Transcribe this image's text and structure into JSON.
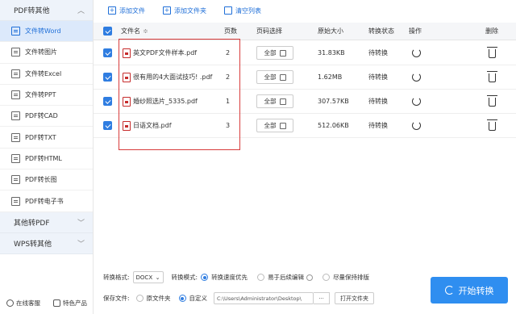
{
  "sidebar": {
    "section_main": "PDF转其他",
    "items": [
      {
        "label": "文件转Word",
        "icon": "word-file-icon",
        "active": true
      },
      {
        "label": "文件转图片",
        "icon": "image-file-icon"
      },
      {
        "label": "文件转Excel",
        "icon": "excel-file-icon"
      },
      {
        "label": "文件转PPT",
        "icon": "ppt-file-icon"
      },
      {
        "label": "PDF转CAD",
        "icon": "cad-file-icon"
      },
      {
        "label": "PDF转TXT",
        "icon": "txt-file-icon"
      },
      {
        "label": "PDF转HTML",
        "icon": "html-file-icon"
      },
      {
        "label": "PDF转长图",
        "icon": "long-image-icon"
      },
      {
        "label": "PDF转电子书",
        "icon": "ebook-icon"
      }
    ],
    "section_other": "其他转PDF",
    "section_wps": "WPS转其他",
    "footer": {
      "service": "在线客服",
      "products": "特色产品"
    }
  },
  "toolbar": {
    "add_file": "添加文件",
    "add_folder": "添加文件夹",
    "clear_list": "清空列表"
  },
  "table": {
    "headers": {
      "name": "文件名",
      "sort": "≑",
      "pages": "页数",
      "page_select": "页码选择",
      "size": "原始大小",
      "status": "转换状态",
      "action": "操作",
      "delete": "删除"
    },
    "page_btn_label": "全部",
    "rows": [
      {
        "name": "英文PDF文件样本.pdf",
        "pages": "2",
        "size": "31.83KB",
        "status": "待转换"
      },
      {
        "name": "很有用的4大面试技巧! .pdf",
        "pages": "2",
        "size": "1.62MB",
        "status": "待转换"
      },
      {
        "name": "婚纱照选片_5335.pdf",
        "pages": "1",
        "size": "307.57KB",
        "status": "待转换"
      },
      {
        "name": "日语文档.pdf",
        "pages": "3",
        "size": "512.06KB",
        "status": "待转换"
      }
    ]
  },
  "bottom": {
    "format_label": "转换格式:",
    "format_value": "DOCX",
    "mode_label": "转换模式:",
    "mode_fast": "转换速度优先",
    "mode_edit": "易于后续编辑",
    "mode_layout": "尽量保持排版",
    "save_label": "保存文件:",
    "save_original": "原文件夹",
    "save_custom": "自定义",
    "save_path": "C:\\Users\\Administrator\\Desktop\\",
    "dots": "···",
    "open_folder": "打开文件夹",
    "start": "开始转换"
  },
  "colors": {
    "accent": "#2f8ef0",
    "active_bg": "#dce9fb",
    "highlight_box": "#d83b3b"
  }
}
